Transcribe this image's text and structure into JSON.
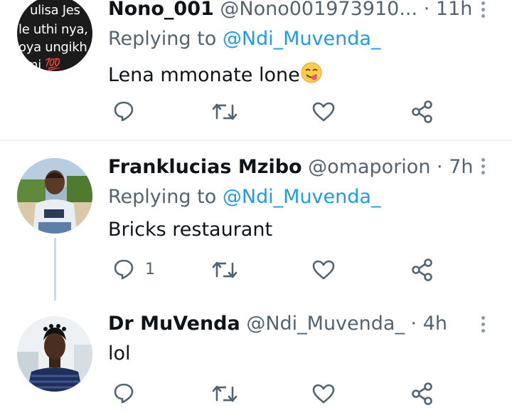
{
  "tweets": [
    {
      "name": "Nono_001",
      "handle": "@Nono001973910...",
      "separator": "·",
      "time": "11h",
      "replying_prefix": "Replying to",
      "replying_handle": "@Ndi_Muvenda_",
      "text": "Lena mmonate lone",
      "emoji": "😋",
      "avatar_text": [
        "ulisa Jes",
        "le uthi nya,",
        "oya ungikh",
        "mi 💯"
      ],
      "reply_count": ""
    },
    {
      "name": "Franklucias Mzibo",
      "handle": "@omaporion",
      "separator": "·",
      "time": "7h",
      "replying_prefix": "Replying to",
      "replying_handle": "@Ndi_Muvenda_",
      "text": "Bricks restaurant",
      "reply_count": "1"
    },
    {
      "name": "Dr MuVenda",
      "handle": "@Ndi_Muvenda_",
      "separator": "·",
      "time": "4h",
      "text": "lol",
      "reply_count": ""
    }
  ],
  "icons": {
    "reply": "reply-icon",
    "retweet": "retweet-icon",
    "like": "heart-icon",
    "share": "share-icon",
    "more": "more-vertical-icon"
  },
  "colors": {
    "mention": "#1d9bf0",
    "secondary_text": "#536471",
    "icon": "#536471"
  }
}
